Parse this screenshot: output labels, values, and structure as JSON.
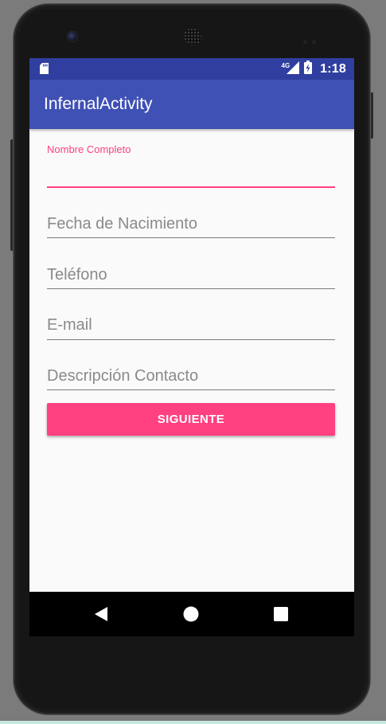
{
  "status_bar": {
    "network_type": "4G",
    "time": "1:18",
    "icons": [
      "sd-card-icon",
      "signal-icon",
      "battery-charging-icon"
    ]
  },
  "app_bar": {
    "title": "InfernalActivity"
  },
  "form": {
    "fields": [
      {
        "label": "Nombre Completo",
        "value": "",
        "placeholder": ""
      },
      {
        "label": "",
        "value": "",
        "placeholder": "Fecha de Nacimiento"
      },
      {
        "label": "",
        "value": "",
        "placeholder": "Teléfono"
      },
      {
        "label": "",
        "value": "",
        "placeholder": "E-mail"
      },
      {
        "label": "",
        "value": "",
        "placeholder": "Descripción Contacto"
      }
    ],
    "submit_label": "SIGUIENTE"
  },
  "nav_bar": {
    "icons": [
      "back-icon",
      "home-icon",
      "recents-icon"
    ]
  },
  "colors": {
    "primary": "#3f51b5",
    "primary_dark": "#303f9f",
    "accent": "#ff4081",
    "background": "#fafafa"
  }
}
